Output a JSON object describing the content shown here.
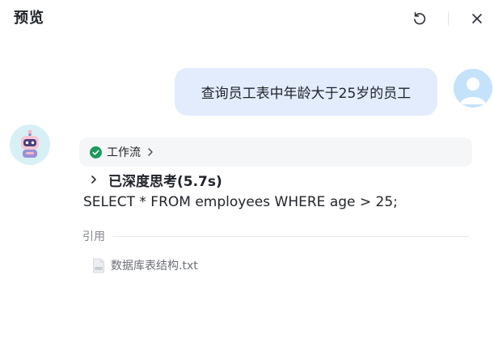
{
  "header": {
    "title": "预览"
  },
  "conversation": {
    "user_message": "查询员工表中年龄大于25岁的员工",
    "workflow": {
      "label": "工作流",
      "status": "success"
    },
    "thinking": {
      "label": "已深度思考(5.7s)"
    },
    "answer": "SELECT * FROM employees WHERE age > 25;",
    "references": {
      "label": "引用",
      "files": [
        {
          "name": "数据库表结构.txt",
          "icon": "txt-file-icon"
        }
      ]
    }
  },
  "icons": {
    "refresh": "refresh-icon",
    "close": "close-icon",
    "check": "check-circle-icon",
    "chevron": "chevron-right-icon"
  },
  "colors": {
    "user_bubble": "#e2ecfd",
    "success": "#1a9a5c",
    "workflow_bg": "#f5f6f8"
  }
}
